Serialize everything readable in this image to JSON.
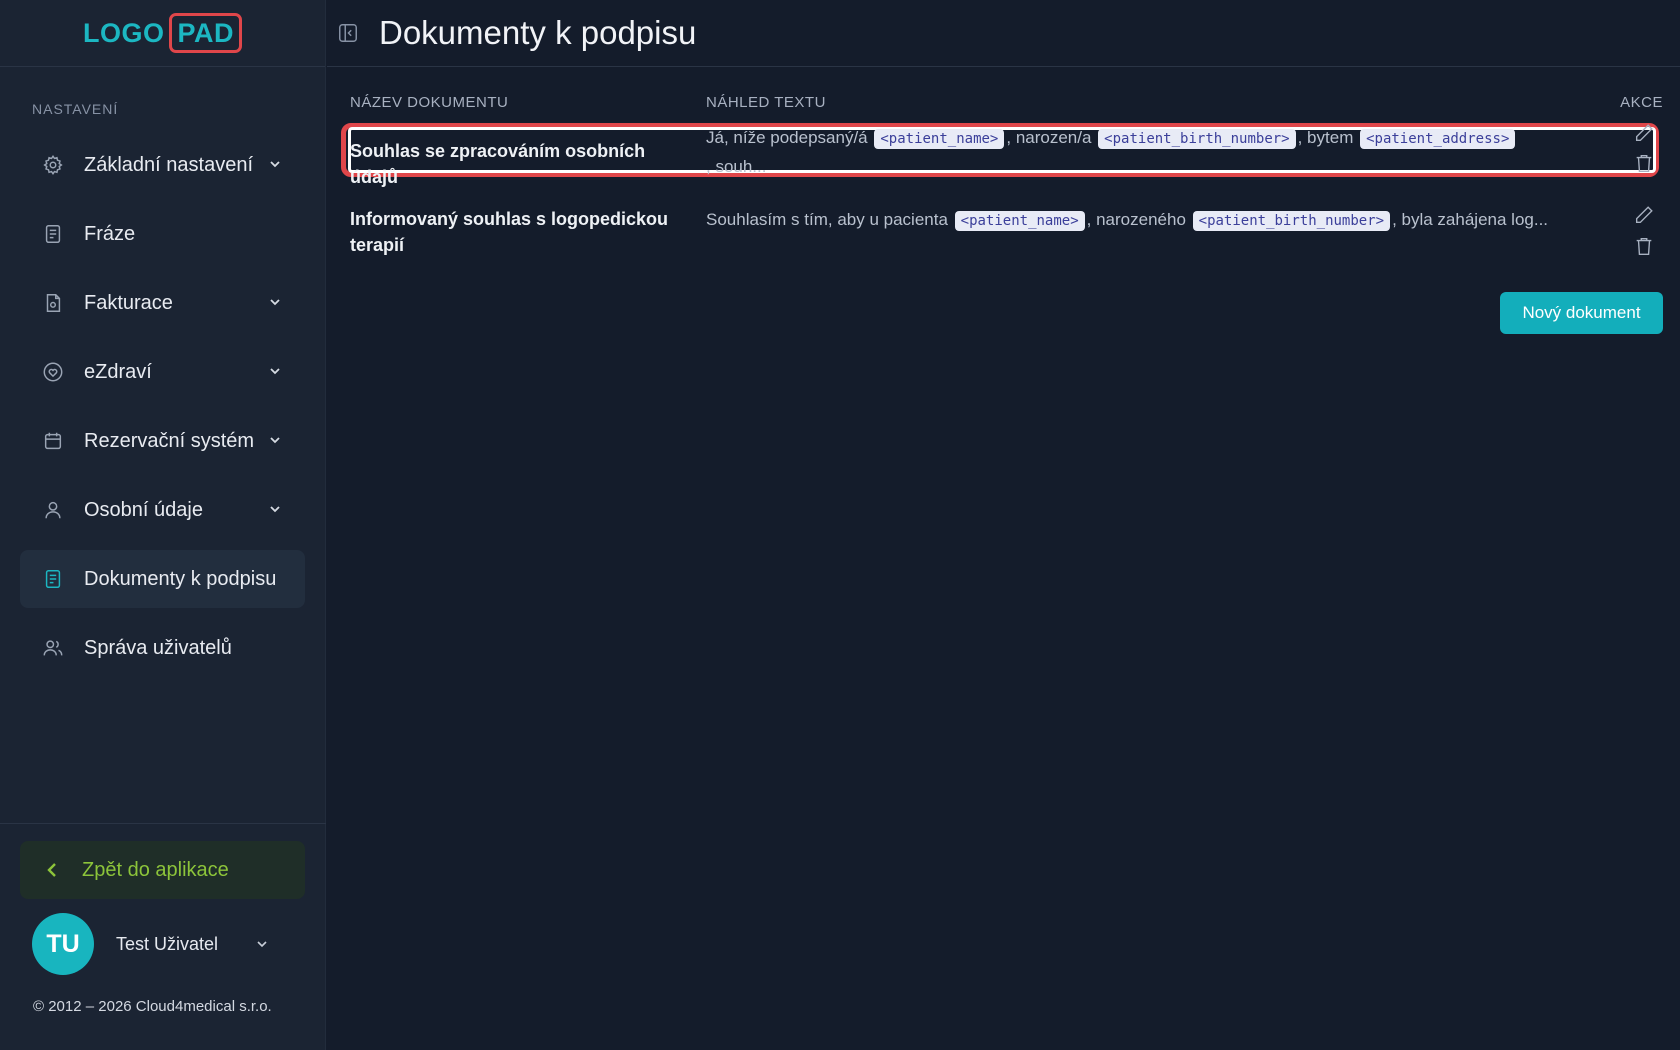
{
  "brand": {
    "logo_part1": "LOGO",
    "logo_part2": "PAD",
    "accent": "#1cb7c2",
    "highlight": "#e0464a"
  },
  "sidebar": {
    "section_label": "NASTAVENÍ",
    "items": [
      {
        "label": "Základní nastavení",
        "icon": "gear-icon",
        "has_chevron": true
      },
      {
        "label": "Fráze",
        "icon": "document-icon",
        "has_chevron": false
      },
      {
        "label": "Fakturace",
        "icon": "invoice-icon",
        "has_chevron": true
      },
      {
        "label": "eZdraví",
        "icon": "heart-icon",
        "has_chevron": true
      },
      {
        "label": "Rezervační systém",
        "icon": "calendar-icon",
        "has_chevron": true
      },
      {
        "label": "Osobní údaje",
        "icon": "user-icon",
        "has_chevron": true
      },
      {
        "label": "Dokumenty k podpisu",
        "icon": "document-icon",
        "has_chevron": false,
        "active": true
      },
      {
        "label": "Správa uživatelů",
        "icon": "users-icon",
        "has_chevron": false
      }
    ],
    "back_label": "Zpět do aplikace",
    "user": {
      "initials": "TU",
      "name": "Test Uživatel"
    },
    "copyright": "© 2012 – 2026 Cloud4medical s.r.o."
  },
  "header": {
    "title": "Dokumenty k podpisu"
  },
  "table": {
    "headers": {
      "name": "NÁZEV DOKUMENTU",
      "preview": "NÁHLED TEXTU",
      "actions": "AKCE"
    },
    "rows": [
      {
        "name": "Souhlas se zpracováním osobních údajů",
        "preview_parts": [
          "Já, níže podepsaný/á",
          "<patient_name>",
          ", narozen/a",
          "<patient_birth_number>",
          ", bytem",
          "<patient_address>",
          ", souh..."
        ]
      },
      {
        "name": "Informovaný souhlas s logopedickou terapií",
        "preview_parts": [
          "Souhlasím s tím, aby u pacienta",
          "<patient_name>",
          ", narozeného",
          "<patient_birth_number>",
          ", byla zahájena log..."
        ]
      }
    ]
  },
  "actions": {
    "new_document": "Nový dokument"
  }
}
